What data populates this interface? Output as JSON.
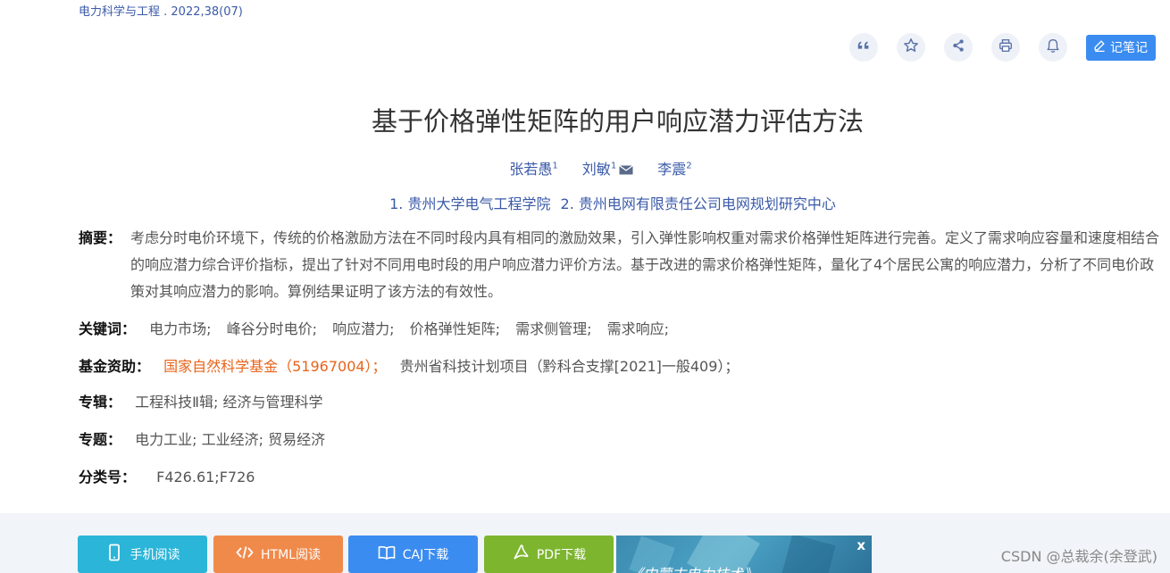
{
  "journal": "电力科学与工程 . 2022,38(07)",
  "toolbar": {
    "items": [
      {
        "name": "cite-icon"
      },
      {
        "name": "star-icon"
      },
      {
        "name": "share-icon"
      },
      {
        "name": "print-icon"
      },
      {
        "name": "bell-icon"
      }
    ],
    "note_label": "记笔记"
  },
  "title": "基于价格弹性矩阵的用户响应潜力评估方法",
  "authors": [
    {
      "name": "张若愚",
      "sup": "1"
    },
    {
      "name": "刘敏",
      "sup": "1",
      "mail": true
    },
    {
      "name": "李震",
      "sup": "2"
    }
  ],
  "affiliations": [
    "1. 贵州大学电气工程学院",
    "2. 贵州电网有限责任公司电网规划研究中心"
  ],
  "abstract": {
    "label": "摘要：",
    "text": "考虑分时电价环境下，传统的价格激励方法在不同时段内具有相同的激励效果，引入弹性影响权重对需求价格弹性矩阵进行完善。定义了需求响应容量和速度相结合的响应潜力综合评价指标，提出了针对不同用电时段的用户响应潜力评价方法。基于改进的需求价格弹性矩阵，量化了4个居民公寓的响应潜力，分析了不同电价政策对其响应潜力的影响。算例结果证明了该方法的有效性。"
  },
  "keywords": {
    "label": "关键词：",
    "items": [
      "电力市场;",
      "峰谷分时电价;",
      "响应潜力;",
      "价格弹性矩阵;",
      "需求侧管理;",
      "需求响应;"
    ]
  },
  "funding": {
    "label": "基金资助：",
    "item1": "国家自然科学基金（51967004）；",
    "item2": "贵州省科技计划项目（黔科合支撑[2021]一般409）；"
  },
  "album": {
    "label": "专辑：",
    "value": "工程科技Ⅱ辑; 经济与管理科学"
  },
  "topic": {
    "label": "专题：",
    "value": "电力工业; 工业经济; 贸易经济"
  },
  "classno": {
    "label": "分类号：",
    "value": "F426.61;F726"
  },
  "downloads": {
    "mobile": {
      "label": "手机阅读",
      "color": "#2bb5d8"
    },
    "html": {
      "label": "HTML阅读",
      "color": "#f08a4b"
    },
    "caj": {
      "label": "CAJ下载",
      "color": "#3b8cf0"
    },
    "pdf": {
      "label": "PDF下载",
      "color": "#7db52f"
    }
  },
  "banner": {
    "text": "《内蒙古电力技术》",
    "close": "x"
  },
  "watermark": "CSDN @总裁余(余登武)"
}
